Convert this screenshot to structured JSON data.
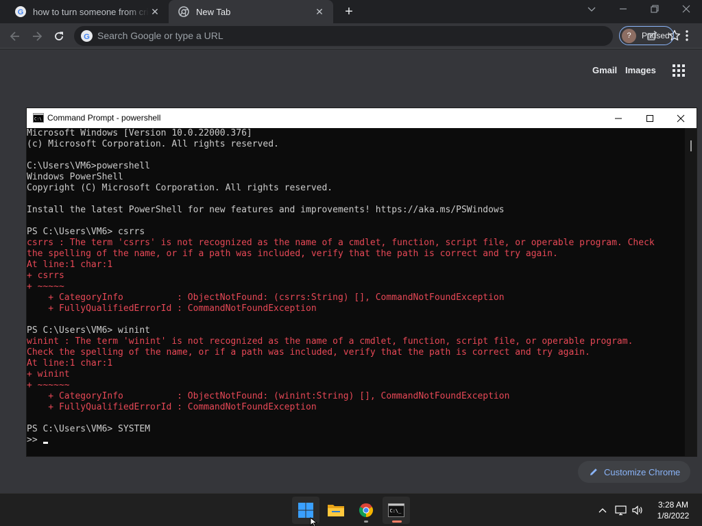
{
  "browser": {
    "tabs": [
      {
        "title": "how to turn someone from cristian",
        "active": false
      },
      {
        "title": "New Tab",
        "active": true
      }
    ],
    "new_tab_symbol": "+",
    "omnibox_placeholder": "Search Google or type a URL",
    "profile": {
      "status": "Paused",
      "initial": "?"
    }
  },
  "ntp": {
    "links": {
      "gmail": "Gmail",
      "images": "Images"
    },
    "customize_label": "Customize Chrome"
  },
  "console": {
    "title": "Command Prompt - powershell",
    "lines": [
      {
        "text": "Microsoft Windows [Version 10.0.22000.376]",
        "type": "out"
      },
      {
        "text": "(c) Microsoft Corporation. All rights reserved.",
        "type": "out"
      },
      {
        "text": "",
        "type": "out"
      },
      {
        "text": "C:\\Users\\VM6>powershell",
        "type": "out"
      },
      {
        "text": "Windows PowerShell",
        "type": "out"
      },
      {
        "text": "Copyright (C) Microsoft Corporation. All rights reserved.",
        "type": "out"
      },
      {
        "text": "",
        "type": "out"
      },
      {
        "text": "Install the latest PowerShell for new features and improvements! https://aka.ms/PSWindows",
        "type": "out"
      },
      {
        "text": "",
        "type": "out"
      },
      {
        "text": "PS C:\\Users\\VM6> csrrs",
        "type": "out"
      },
      {
        "text": "csrrs : The term 'csrrs' is not recognized as the name of a cmdlet, function, script file, or operable program. Check",
        "type": "err"
      },
      {
        "text": "the spelling of the name, or if a path was included, verify that the path is correct and try again.",
        "type": "err"
      },
      {
        "text": "At line:1 char:1",
        "type": "err"
      },
      {
        "text": "+ csrrs",
        "type": "err"
      },
      {
        "text": "+ ~~~~~",
        "type": "err"
      },
      {
        "text": "    + CategoryInfo          : ObjectNotFound: (csrrs:String) [], CommandNotFoundException",
        "type": "err"
      },
      {
        "text": "    + FullyQualifiedErrorId : CommandNotFoundException",
        "type": "err"
      },
      {
        "text": "",
        "type": "out"
      },
      {
        "text": "PS C:\\Users\\VM6> winint",
        "type": "out"
      },
      {
        "text": "winint : The term 'winint' is not recognized as the name of a cmdlet, function, script file, or operable program.",
        "type": "err"
      },
      {
        "text": "Check the spelling of the name, or if a path was included, verify that the path is correct and try again.",
        "type": "err"
      },
      {
        "text": "At line:1 char:1",
        "type": "err"
      },
      {
        "text": "+ winint",
        "type": "err"
      },
      {
        "text": "+ ~~~~~~",
        "type": "err"
      },
      {
        "text": "    + CategoryInfo          : ObjectNotFound: (winint:String) [], CommandNotFoundException",
        "type": "err"
      },
      {
        "text": "    + FullyQualifiedErrorId : CommandNotFoundException",
        "type": "err"
      },
      {
        "text": "",
        "type": "out"
      },
      {
        "text": "PS C:\\Users\\VM6> SYSTEM",
        "type": "out"
      }
    ],
    "prompt": ">> "
  },
  "taskbar": {
    "apps": [
      "start-button",
      "file-explorer",
      "chrome",
      "command-prompt"
    ],
    "time": "3:28 AM",
    "date": "1/8/2022"
  },
  "colors": {
    "chrome_frame": "#202124",
    "toolbar": "#35363a",
    "accent_blue": "#8ab4f8",
    "console_bg": "#0c0c0c",
    "console_text": "#cccccc",
    "console_error": "#e74856",
    "taskbar": "#202020"
  }
}
